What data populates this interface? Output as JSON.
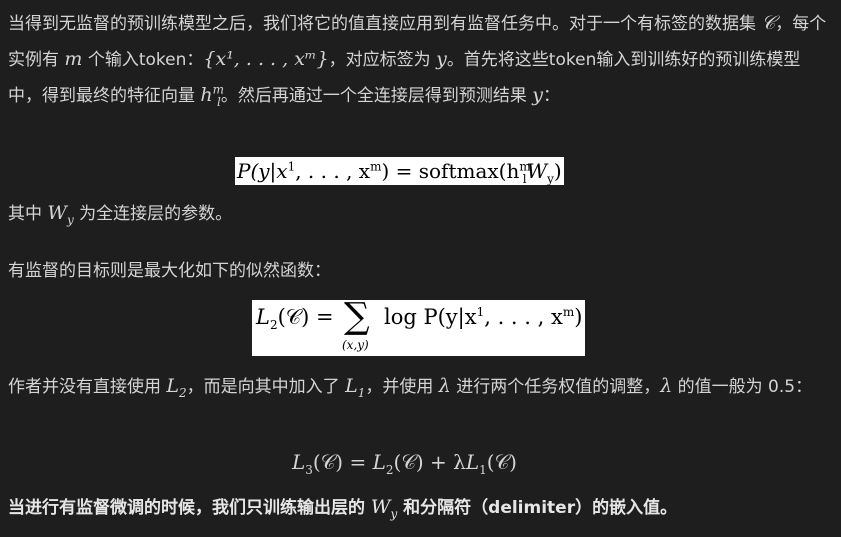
{
  "paragraph1": {
    "part1": "当得到无监督的预训练模型之后，我们将它的值直接应用到有监督任务中。对于一个有标签的数据集 ",
    "dataset_symbol": "𝒞",
    "part2": "，每个实例有 ",
    "m_symbol": "m",
    "part3": " 个输入token：",
    "token_set": "{x¹, . . . , xᵐ}",
    "part4": "，对应标签为 ",
    "y_symbol": "y",
    "part5": "。首先将这些token输入到训练好的预训练模型中，得到最终的特征向量 ",
    "h_symbol": "h",
    "h_sup": "m",
    "h_sub": "l",
    "part6": "。然后再通过一个全连接层得到预测结果 ",
    "y_symbol2": "y",
    "part7": "："
  },
  "equation1": {
    "lhs": "P(y|x",
    "sup1": "1",
    "mid": ", . . . , x",
    "sup2": "m",
    "rhs_open": ") = softmax(h",
    "h_sup": "m",
    "h_sub": "l",
    "w": "W",
    "w_sub": "y",
    "close": ")"
  },
  "paragraph2": {
    "part1": "其中 ",
    "w_symbol": "W",
    "w_sub": "y",
    "part2": " 为全连接层的参数。"
  },
  "paragraph3": {
    "text": "有监督的目标则是最大化如下的似然函数："
  },
  "equation2": {
    "lhs": "L",
    "lhs_sub": "2",
    "lhs_arg": "(𝒞) =",
    "sigma": "∑",
    "under": "(x,y)",
    "rhs1": "log P(y|x",
    "sup1": "1",
    "rhs2": ", . . . , x",
    "sup2": "m",
    "rhs3": ")"
  },
  "paragraph4": {
    "part1": "作者并没有直接使用 ",
    "l2": "L",
    "l2_sub": "2",
    "part2": "，而是向其中加入了 ",
    "l1": "L",
    "l1_sub": "1",
    "part3": "，并使用 ",
    "lambda1": "λ",
    "part4": " 进行两个任务权值的调整，",
    "lambda2": "λ",
    "part5": " 的值一般为 0.5："
  },
  "equation3": {
    "l3": "L",
    "l3_sub": "3",
    "l3_arg": "(𝒞) = ",
    "l2": "L",
    "l2_sub": "2",
    "l2_arg": "(𝒞) + λ",
    "l1": "L",
    "l1_sub": "1",
    "l1_arg": "(𝒞)"
  },
  "paragraph5": {
    "part1": "当进行有监督微调的时候，我们只训练输出层的 ",
    "w_symbol": "W",
    "w_sub": "y",
    "part2": " 和分隔符（delimiter）的嵌入值。"
  }
}
